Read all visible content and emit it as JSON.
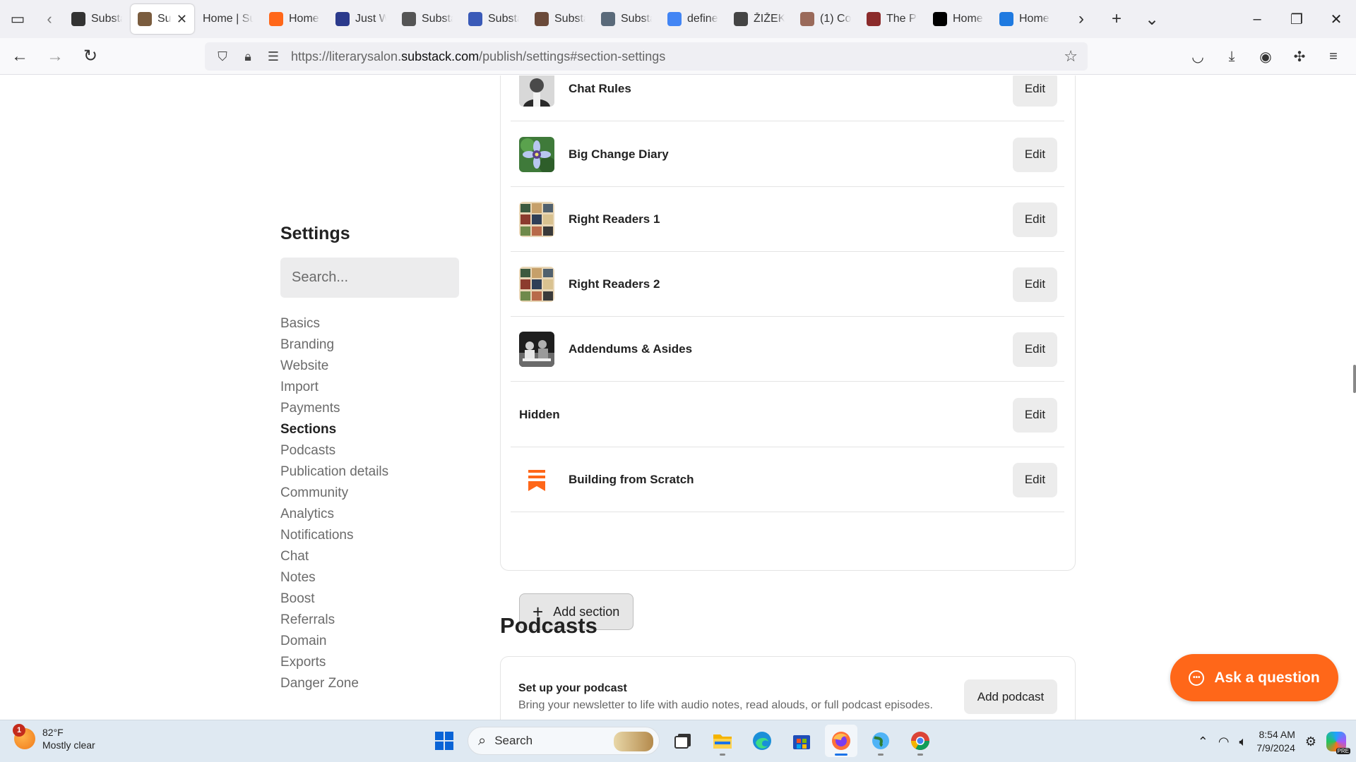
{
  "browser": {
    "tabs": [
      {
        "label": "Substa",
        "icon": "substack-favicon-icon",
        "color": "#333333",
        "active": false
      },
      {
        "label": "Sub",
        "icon": "substack-favicon-icon",
        "color": "#7a5c3e",
        "active": true
      },
      {
        "label": "Home | Su",
        "icon": "",
        "color": "",
        "active": false
      },
      {
        "label": "Home",
        "icon": "substack-logo-icon",
        "color": "#ff6719",
        "active": false
      },
      {
        "label": "Just W",
        "icon": "image-favicon-icon",
        "color": "#2b3a8c",
        "active": false
      },
      {
        "label": "Substa",
        "icon": "hat-favicon-icon",
        "color": "#555555",
        "active": false
      },
      {
        "label": "Substa",
        "icon": "u-favicon-icon",
        "color": "#3a5ab8",
        "active": false
      },
      {
        "label": "Substa",
        "icon": "portrait-favicon-icon",
        "color": "#6b4a3a",
        "active": false
      },
      {
        "label": "Substa",
        "icon": "photo-favicon-icon",
        "color": "#5a6a7a",
        "active": false
      },
      {
        "label": "define",
        "icon": "google-icon",
        "color": "#4285f4",
        "active": false
      },
      {
        "label": "ŽIŽEK",
        "icon": "portrait-favicon-icon",
        "color": "#444444",
        "active": false
      },
      {
        "label": "(1) Co",
        "icon": "avatar-favicon-icon",
        "color": "#9a6a5a",
        "active": false
      },
      {
        "label": "The Pe",
        "icon": "shield-favicon-icon",
        "color": "#8b2b2b",
        "active": false
      },
      {
        "label": "Home",
        "icon": "x-logo-icon",
        "color": "#000000",
        "active": false
      },
      {
        "label": "Home",
        "icon": "c-favicon-icon",
        "color": "#1f7ae0",
        "active": false
      }
    ],
    "url": {
      "prefix": "https://literarysalon.",
      "domain": "substack.com",
      "path": "/publish/settings#section-settings"
    }
  },
  "sidebar": {
    "title": "Settings",
    "search_placeholder": "Search...",
    "items": [
      {
        "label": "Basics",
        "active": false
      },
      {
        "label": "Branding",
        "active": false
      },
      {
        "label": "Website",
        "active": false
      },
      {
        "label": "Import",
        "active": false
      },
      {
        "label": "Payments",
        "active": false
      },
      {
        "label": "Sections",
        "active": true
      },
      {
        "label": "Podcasts",
        "active": false
      },
      {
        "label": "Publication details",
        "active": false
      },
      {
        "label": "Community",
        "active": false
      },
      {
        "label": "Analytics",
        "active": false
      },
      {
        "label": "Notifications",
        "active": false
      },
      {
        "label": "Chat",
        "active": false
      },
      {
        "label": "Notes",
        "active": false
      },
      {
        "label": "Boost",
        "active": false
      },
      {
        "label": "Referrals",
        "active": false
      },
      {
        "label": "Domain",
        "active": false
      },
      {
        "label": "Exports",
        "active": false
      },
      {
        "label": "Danger Zone",
        "active": false
      }
    ]
  },
  "sections": {
    "edit_label": "Edit",
    "add_label": "Add section",
    "items": [
      {
        "name": "Chat Rules",
        "thumb": "portrait"
      },
      {
        "name": "Big Change Diary",
        "thumb": "flower"
      },
      {
        "name": "Right Readers 1",
        "thumb": "collage"
      },
      {
        "name": "Right Readers 2",
        "thumb": "collage"
      },
      {
        "name": "Addendums & Asides",
        "thumb": "bw-photo"
      },
      {
        "name": "Hidden",
        "thumb": "none"
      },
      {
        "name": "Building from Scratch",
        "thumb": "substack"
      }
    ]
  },
  "podcasts": {
    "title": "Podcasts",
    "card_title": "Set up your podcast",
    "card_desc": "Bring your newsletter to life with audio notes, read alouds, or full podcast episodes.",
    "add_label": "Add podcast"
  },
  "help": {
    "ask_label": "Ask a question"
  },
  "taskbar": {
    "weather_temp": "82°F",
    "weather_desc": "Mostly clear",
    "weather_badge": "1",
    "search_label": "Search",
    "time": "8:54 AM",
    "date": "7/9/2024",
    "copilot_badge": "PRE"
  },
  "colors": {
    "accent": "#ff6719",
    "tab_strip": "#f0f0f4",
    "taskbar": "#dfe9f2"
  }
}
